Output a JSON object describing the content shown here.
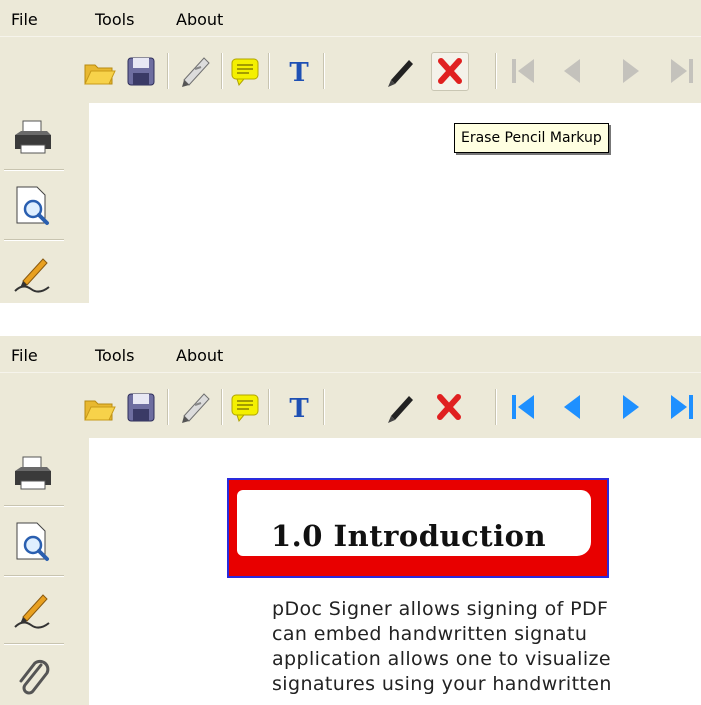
{
  "menu": [
    {
      "label": "File"
    },
    {
      "label": "Tools"
    },
    {
      "label": "About"
    }
  ],
  "tooltip": "Erase Pencil Markup",
  "toolbar_icons": [
    "open-folder-icon",
    "save-icon",
    "sign-pen-icon",
    "comment-note-icon",
    "text-tool-icon",
    "pencil-icon",
    "erase-markup-icon",
    "first-page-icon",
    "previous-page-icon",
    "next-page-icon",
    "last-page-icon"
  ],
  "sidebar_icons": [
    "print-icon",
    "preview-magnify-icon",
    "signature-pen-icon",
    "attachment-paperclip-icon"
  ],
  "document": {
    "heading": "1.0 Introduction",
    "lines": [
      "pDoc Signer allows signing of PDF",
      "can  embed  handwritten  signatu",
      "application allows one to visualize",
      "signatures using your handwritten"
    ]
  },
  "colors": {
    "chrome": "#ece9d8",
    "nav_disabled": "#c4c2bc",
    "nav_enabled": "#1e90ff",
    "erase_red": "#e02020",
    "comment_yellow": "#f4f000",
    "intro_border_red": "#e80000",
    "intro_border_blue": "#2a2adc"
  }
}
